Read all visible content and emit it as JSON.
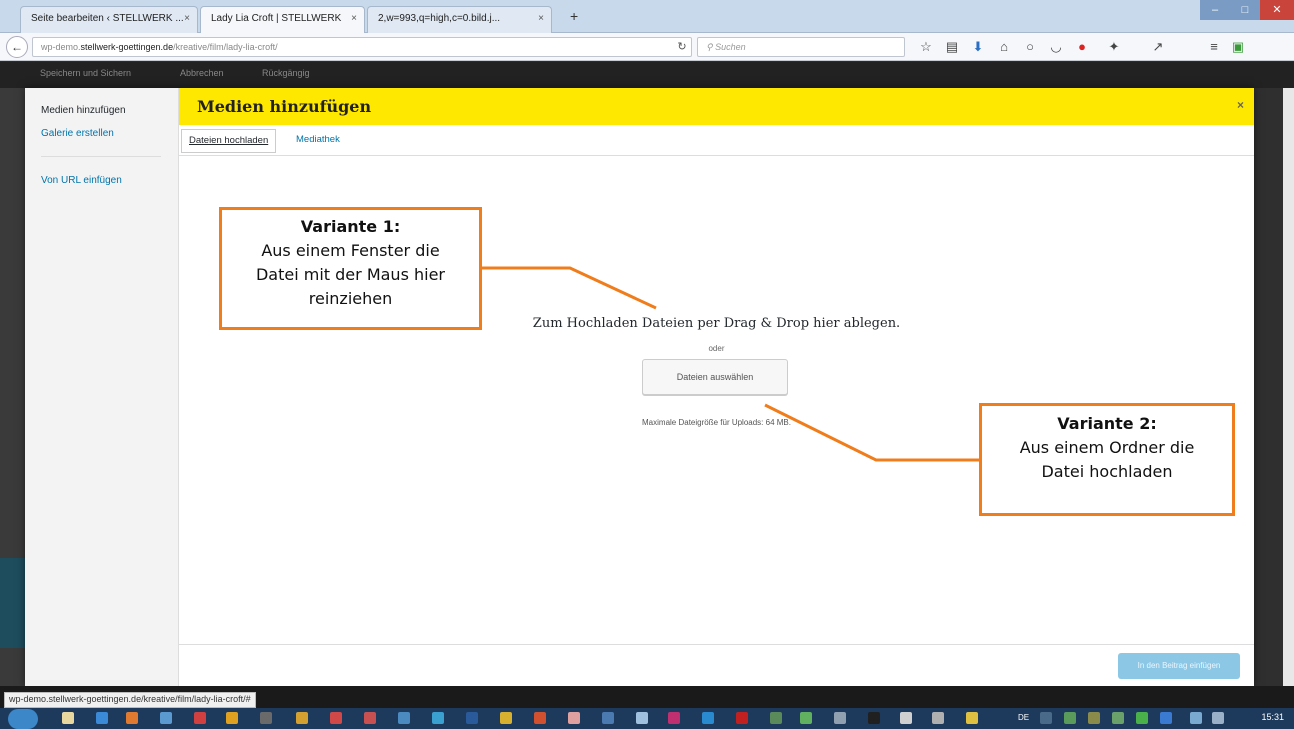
{
  "browser": {
    "tabs": [
      {
        "label": "Seite bearbeiten ‹ STELLWERK ...",
        "active": false
      },
      {
        "label": "Lady Lia Croft | STELLWERK",
        "active": true
      },
      {
        "label": "2,w=993,q=high,c=0.bild.j...",
        "active": false
      }
    ],
    "tab_close": "×",
    "new_tab": "+",
    "url_prefix": "wp-demo.",
    "url_host": "stellwerk-goettingen.de",
    "url_path": "/kreative/film/lady-lia-croft/",
    "search_placeholder": "Suchen",
    "status_url": "wp-demo.stellwerk-goettingen.de/kreative/film/lady-lia-croft/#"
  },
  "admin_bar": {
    "items": [
      "Speichern und Sichern",
      "Abbrechen",
      "Rückgängig"
    ]
  },
  "modal": {
    "menu": {
      "add_media": "Medien hinzufügen",
      "create_gallery": "Galerie erstellen",
      "insert_from_url": "Von URL einfügen"
    },
    "title": "Medien hinzufügen",
    "close": "×",
    "tabs": {
      "upload": "Dateien hochladen",
      "library": "Mediathek"
    },
    "upload": {
      "instructions": "Zum Hochladen Dateien per Drag & Drop hier ablegen.",
      "or": "oder",
      "select_button": "Dateien auswählen",
      "max_size": "Maximale Dateigröße für Uploads: 64 MB."
    },
    "insert_button": "In den Beitrag einfügen"
  },
  "annotations": {
    "variant1_title": "Variante 1:",
    "variant1_line1": "Aus einem Fenster die",
    "variant1_line2": "Datei mit der Maus hier",
    "variant1_line3": "reinziehen",
    "variant2_title": "Variante 2:",
    "variant2_line1": "Aus einem Ordner die",
    "variant2_line2": "Datei hochladen",
    "color": "#f07d1b"
  },
  "taskbar": {
    "lang": "DE",
    "clock": "15:31"
  }
}
